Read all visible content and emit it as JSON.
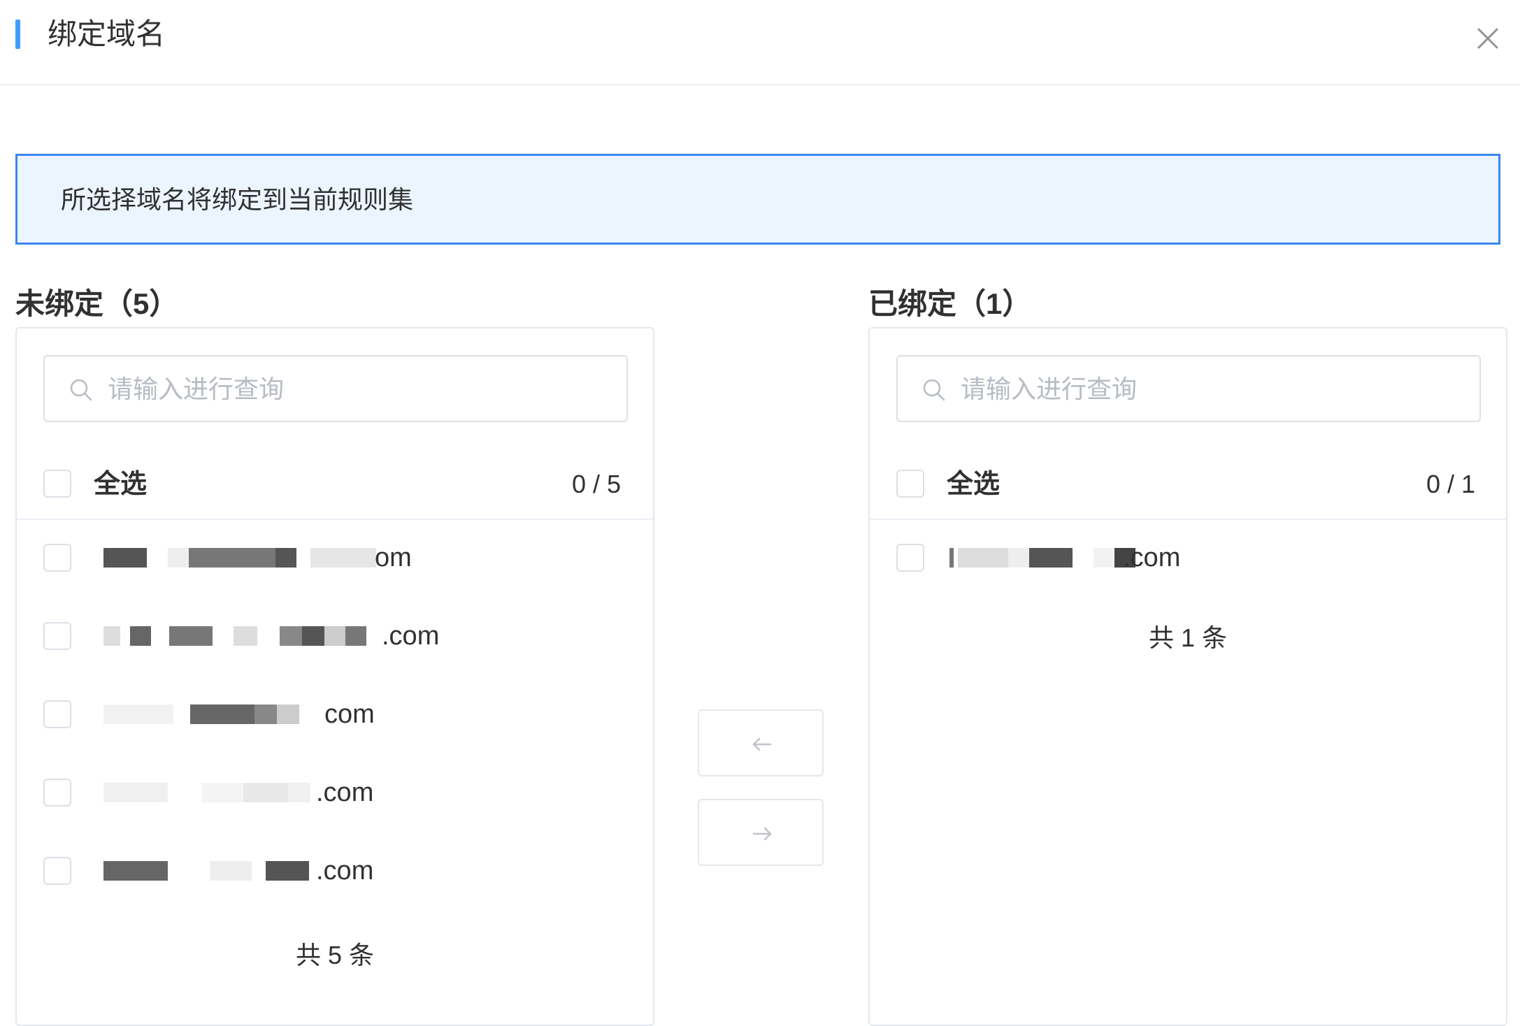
{
  "dialog": {
    "title": "绑定域名",
    "notice": "所选择域名将绑定到当前规则集"
  },
  "unbound": {
    "title": "未绑定（5）",
    "search_placeholder": "请输入进行查询",
    "select_all_label": "全选",
    "count": "0 / 5",
    "items": [
      {
        "suffix": "om"
      },
      {
        "suffix": ".com"
      },
      {
        "suffix": "com"
      },
      {
        "suffix": ".com"
      },
      {
        "suffix": ".com"
      }
    ],
    "total": "共 5 条"
  },
  "bound": {
    "title": "已绑定（1）",
    "search_placeholder": "请输入进行查询",
    "select_all_label": "全选",
    "count": "0 / 1",
    "items": [
      {
        "suffix": ".com"
      }
    ],
    "total": "共 1 条"
  },
  "icons": {
    "close": "close-icon",
    "search": "search-icon",
    "move_left": "arrow-left-icon",
    "move_right": "arrow-right-icon"
  },
  "colors": {
    "accent": "#409eff",
    "notice_bg": "#ecf5ff",
    "notice_border": "#3a86f0"
  }
}
